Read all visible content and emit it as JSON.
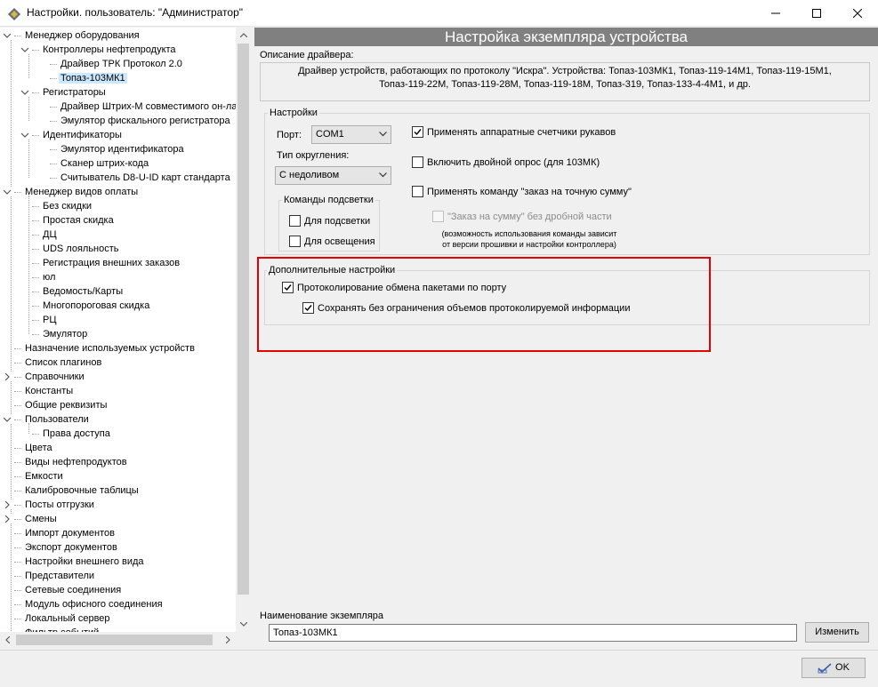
{
  "window": {
    "title": "Настройки. пользователь: \"Администратор\""
  },
  "tree": {
    "items": [
      {
        "label": "Менеджер оборудования",
        "expanded": true
      },
      {
        "label": "Контроллеры нефтепродукта",
        "expanded": true
      },
      {
        "label": "Драйвер ТРК Протокол 2.0"
      },
      {
        "label": "Топаз-103МК1",
        "selected": true
      },
      {
        "label": "Регистраторы",
        "expanded": true
      },
      {
        "label": "Драйвер Штрих-М совместимого он-лай"
      },
      {
        "label": "Эмулятор фискального регистратора"
      },
      {
        "label": "Идентификаторы",
        "expanded": true
      },
      {
        "label": "Эмулятор идентификатора"
      },
      {
        "label": "Сканер штрих-кода"
      },
      {
        "label": "Считыватель D8-U-ID карт стандарта"
      },
      {
        "label": "Менеджер видов оплаты",
        "expanded": true
      },
      {
        "label": "Без скидки"
      },
      {
        "label": "Простая скидка"
      },
      {
        "label": "ДЦ"
      },
      {
        "label": "UDS лояльность"
      },
      {
        "label": "Регистрация внешних заказов"
      },
      {
        "label": "юл"
      },
      {
        "label": "Ведомость/Карты"
      },
      {
        "label": "Многопороговая скидка"
      },
      {
        "label": "РЦ"
      },
      {
        "label": "Эмулятор"
      },
      {
        "label": "Назначение используемых устройств"
      },
      {
        "label": "Список плагинов"
      },
      {
        "label": "Справочники",
        "collapsed": true
      },
      {
        "label": "Константы"
      },
      {
        "label": "Общие реквизиты"
      },
      {
        "label": "Пользователи",
        "expanded": true
      },
      {
        "label": "Права доступа"
      },
      {
        "label": "Цвета"
      },
      {
        "label": "Виды нефтепродуктов"
      },
      {
        "label": "Емкости"
      },
      {
        "label": "Калибровочные таблицы"
      },
      {
        "label": "Посты отгрузки",
        "collapsed": true
      },
      {
        "label": "Смены",
        "collapsed": true
      },
      {
        "label": "Импорт документов"
      },
      {
        "label": "Экспорт документов"
      },
      {
        "label": "Настройки внешнего вида"
      },
      {
        "label": "Представители"
      },
      {
        "label": "Сетевые соединения"
      },
      {
        "label": "Модуль офисного соединения"
      },
      {
        "label": "Локальный сервер"
      },
      {
        "label": "Фильтр событий"
      }
    ]
  },
  "panel": {
    "header": "Настройка экземпляра устройства",
    "driver_desc_label": "Описание драйвера:",
    "driver_desc_line1": "Драйвер устройств, работающих по протоколу \"Искра\". Устройства: Топаз-103МК1, Топаз-119-14М1, Топаз-119-15М1,",
    "driver_desc_line2": "Топаз-119-22М, Топаз-119-28М, Топаз-119-18М, Топаз-319, Топаз-133-4-4М1, и др.",
    "settings": {
      "title": "Настройки",
      "port_label": "Порт:",
      "port_value": "COM1",
      "rounding_label": "Тип округления:",
      "rounding_value": "С недоливом",
      "backlight_group": "Команды подсветки",
      "backlight_cb": "Для подсветки",
      "lighting_cb": "Для освещения",
      "hw_counters_cb": "Применять аппаратные счетчики рукавов",
      "double_poll_cb": "Включить двойной опрос (для 103МК)",
      "exact_sum_cb": "Применять команду \"заказ на точную сумму\"",
      "sum_no_fraction_cb": "\"Заказ на сумму\" без дробной части",
      "note_line1": "(возможность использования команды зависит",
      "note_line2": "от версии прошивки и настройки контроллера)"
    },
    "extra": {
      "title": "Дополнительные настройки",
      "log_exchange_cb": "Протоколирование обмена пакетами по порту",
      "save_unlimited_cb": "Сохранять без ограничения объемов протоколируемой информации"
    },
    "instance": {
      "label": "Наименование экземпляра",
      "value": "Топаз-103МК1",
      "change_button": "Изменить"
    }
  },
  "footer": {
    "ok_button": "OK"
  },
  "colors": {
    "header_bg": "#808080",
    "selection_bg": "#cce8ff",
    "highlight_border": "#e60000"
  }
}
